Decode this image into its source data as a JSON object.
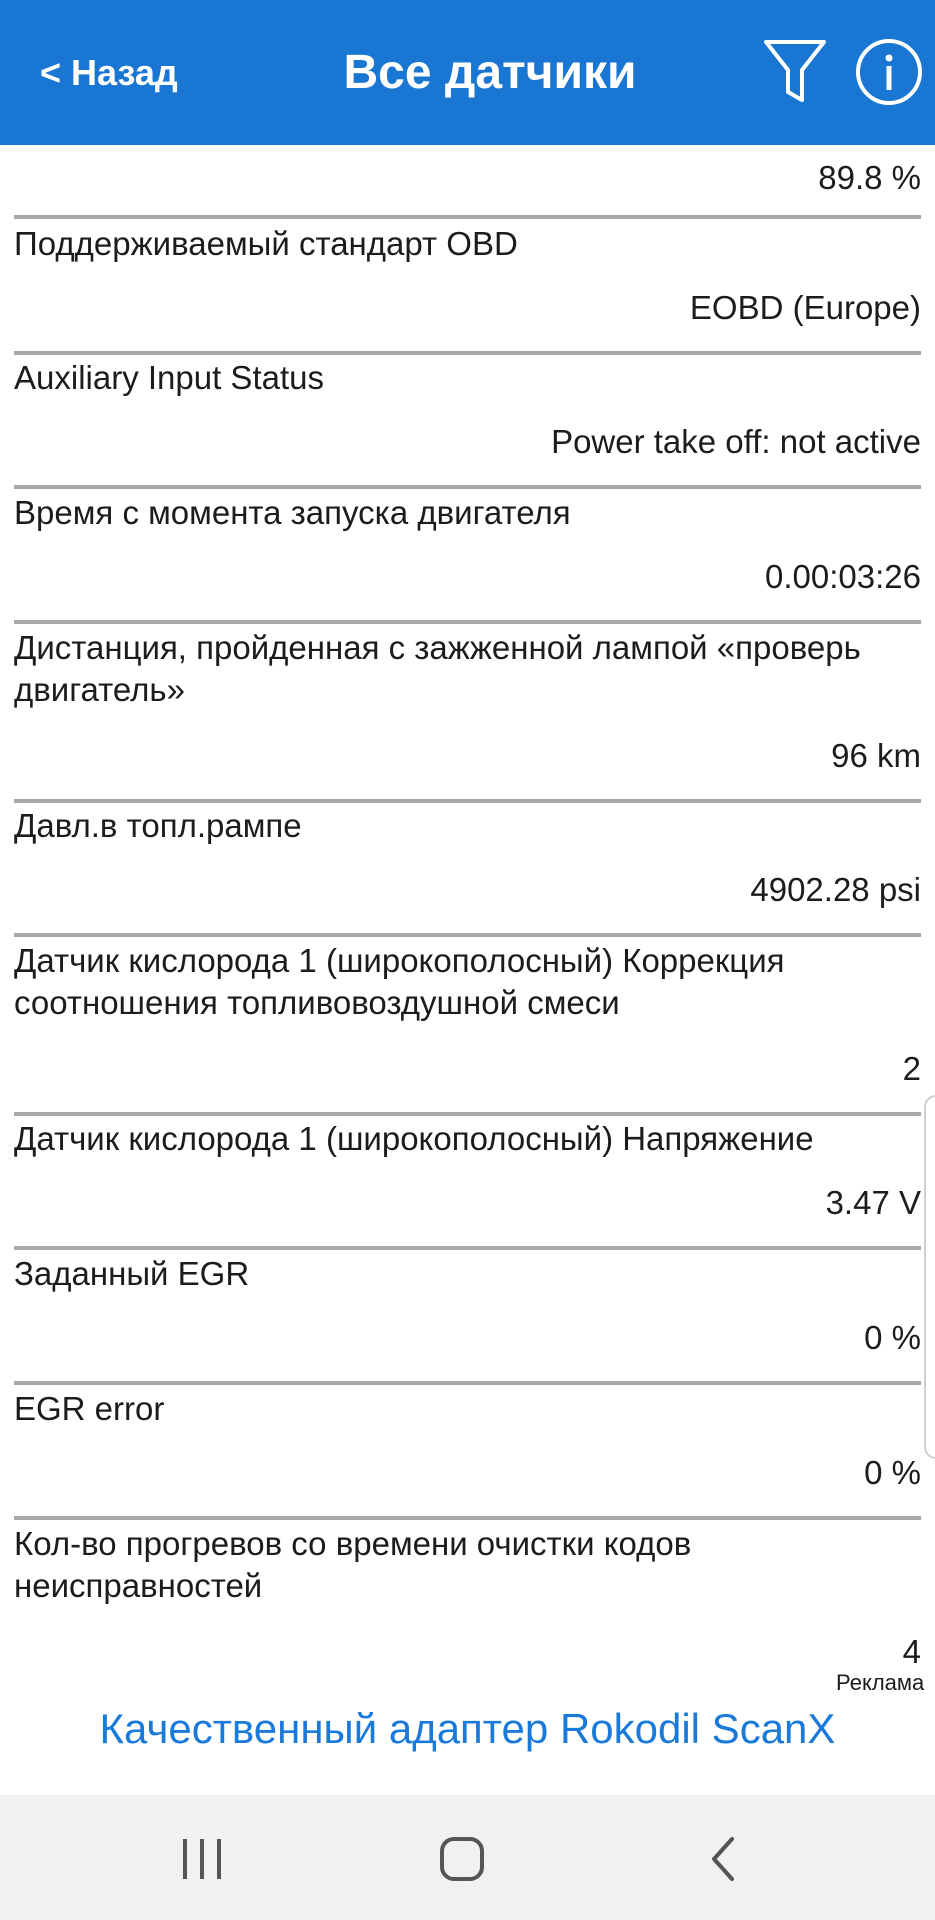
{
  "header": {
    "back_label": "Назад",
    "back_chevron": "<",
    "title": "Все датчики",
    "filter_icon": "filter-funnel-icon",
    "info_icon": "info-icon"
  },
  "colors": {
    "appbar": "#1976d2",
    "ad_link": "#1a7ad9",
    "divider": "#a9a9a9"
  },
  "sensors": [
    {
      "name": "",
      "value": "89.8 %"
    },
    {
      "name": "Поддерживаемый стандарт OBD",
      "value": "EOBD (Europe)"
    },
    {
      "name": "Auxiliary Input Status",
      "value": "Power take off: not active"
    },
    {
      "name": "Время с момента запуска двигателя",
      "value": "0.00:03:26"
    },
    {
      "name": "Дистанция, пройденная с зажженной лампой «проверь двигатель»",
      "value": "96 km"
    },
    {
      "name": "Давл.в топл.рампе",
      "value": "4902.28 psi"
    },
    {
      "name": "Датчик кислорода 1 (широкополосный) Коррекция соотношения топливовоздушной смеси",
      "value": "2"
    },
    {
      "name": "Датчик кислорода 1 (широкополосный) Напряжение",
      "value": "3.47 V"
    },
    {
      "name": "Заданный EGR",
      "value": "0 %"
    },
    {
      "name": "EGR error",
      "value": "0 %"
    },
    {
      "name": "Кол-во прогревов со времени очистки кодов неисправностей",
      "value": "4"
    }
  ],
  "ad": {
    "label": "Реклама",
    "link_text": "Качественный адаптер Rokodil ScanX"
  },
  "system_nav": {
    "recents_icon": "recent-apps-icon",
    "home_icon": "home-icon",
    "back_icon": "back-icon"
  }
}
